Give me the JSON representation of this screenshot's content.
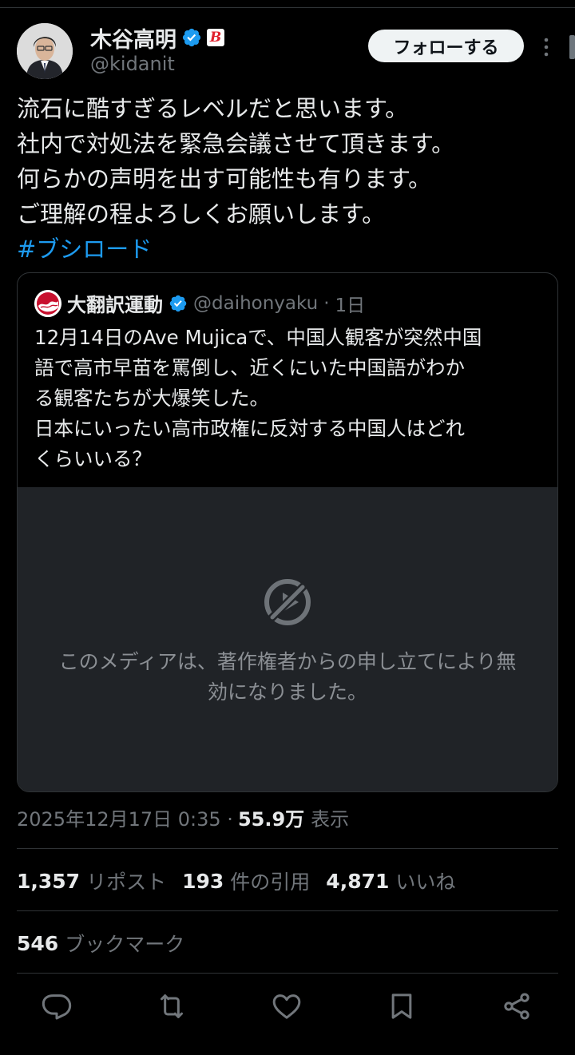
{
  "author": {
    "display_name": "木谷高明",
    "handle": "@kidanit",
    "affiliate_badge_letter": "B",
    "verified_color": "#1d9bf0"
  },
  "follow_button": {
    "label": "フォローする"
  },
  "tweet": {
    "lines": [
      "流石に酷すぎるレベルだと思います。",
      "社内で対処法を緊急会議させて頂きます。",
      "何らかの声明を出す可能性も有ります。",
      "ご理解の程よろしくお願いします。"
    ],
    "hashtag": "#ブシロード"
  },
  "quote": {
    "name": "大翻訳運動",
    "handle": "@daihonyaku",
    "separator": "·",
    "time": "1日",
    "lines": [
      "12月14日のAve Mujicaで、中国人観客が突然中国",
      "語で高市早苗を罵倒し、近くにいた中国語がわか",
      "る観客たちが大爆笑した。",
      "日本にいったい高市政権に反対する中国人はどれ",
      "くらいいる？"
    ],
    "media_notice_lines": [
      "このメディアは、著作権者からの申し立てにより無",
      "効になりました。"
    ]
  },
  "meta": {
    "timestamp": "2025年12月17日 0:35 ·",
    "views_count": "55.9万",
    "views_label": "表示"
  },
  "stats": {
    "reposts": {
      "count": "1,357",
      "label": "リポスト"
    },
    "quotes": {
      "count": "193",
      "label": "件の引用"
    },
    "likes": {
      "count": "4,871",
      "label": "いいね"
    },
    "bookmarks": {
      "count": "546",
      "label": "ブックマーク"
    }
  },
  "actions": [
    "reply-icon",
    "repost-icon",
    "like-icon",
    "bookmark-icon",
    "share-icon"
  ],
  "colors": {
    "background": "#000000",
    "text": "#e7e9ea",
    "secondary_text": "#71767b",
    "link": "#1d9bf0",
    "divider": "#2f3336"
  }
}
